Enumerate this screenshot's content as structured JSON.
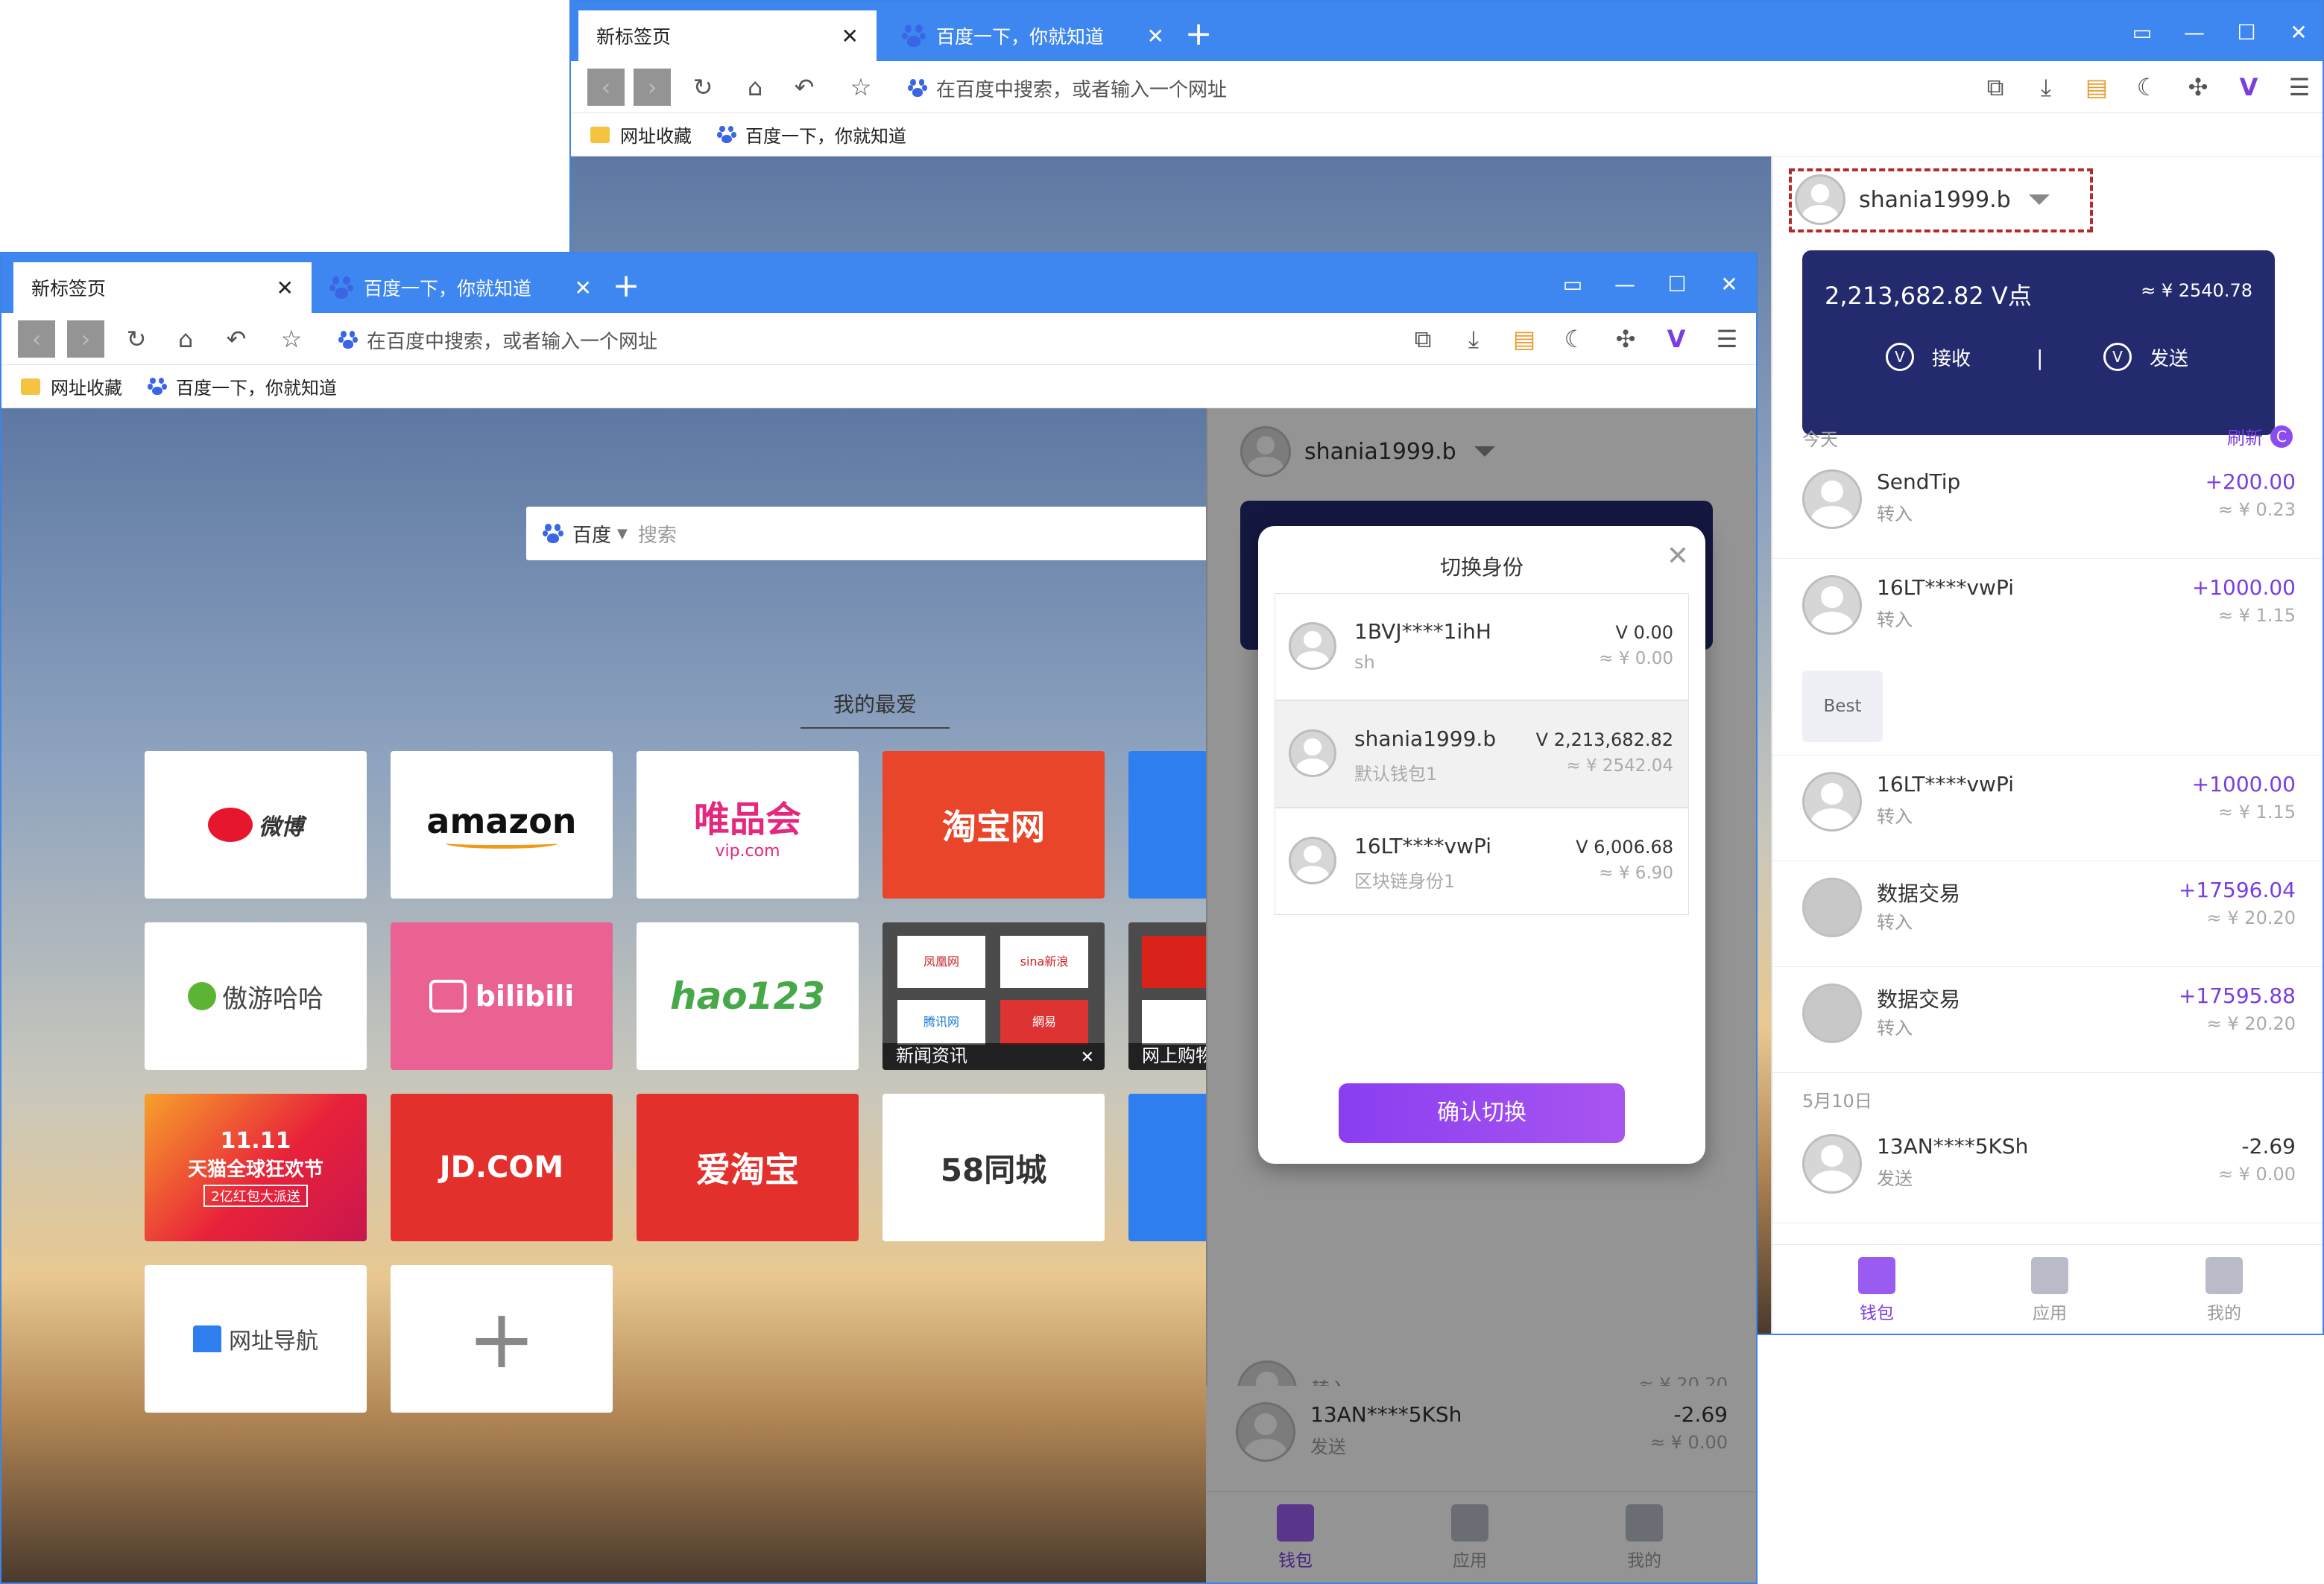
{
  "browser": {
    "tabs": [
      {
        "label": "新标签页"
      },
      {
        "label": "百度一下，你就知道"
      }
    ],
    "address_placeholder": "在百度中搜索，或者输入一个网址",
    "bookmarks": [
      {
        "label": "网址收藏"
      },
      {
        "label": "百度一下，你就知道"
      }
    ]
  },
  "wallet": {
    "account": "shania1999.b",
    "balance": "2,213,682.82 V点",
    "balance_cny": "≈ ¥ 2540.78",
    "receive": "接收",
    "send": "发送",
    "divider": "|",
    "today": "今天",
    "refresh": "刷新",
    "tooltip": "Best",
    "day2": "5月10日",
    "transactions": [
      {
        "name": "SendTip",
        "sub": "转入",
        "amount": "+200.00",
        "cny": "≈ ¥ 0.23"
      },
      {
        "name": "16LT****vwPi",
        "sub": "转入",
        "amount": "+1000.00",
        "cny": "≈ ¥ 1.15"
      },
      {
        "name": "16LT****vwPi",
        "sub": "转入",
        "amount": "+1000.00",
        "cny": "≈ ¥ 1.15"
      },
      {
        "name": "数据交易",
        "sub": "转入",
        "amount": "+17596.04",
        "cny": "≈ ¥ 20.20"
      },
      {
        "name": "数据交易",
        "sub": "转入",
        "amount": "+17595.88",
        "cny": "≈ ¥ 20.20"
      },
      {
        "name": "13AN****5KSh",
        "sub": "发送",
        "amount": "-2.69",
        "cny": "≈ ¥ 0.00"
      }
    ],
    "bg_row_sub": "转入",
    "bg_row_cny": "≈ ¥ 20.20",
    "nav": [
      "钱包",
      "应用",
      "我的"
    ]
  },
  "newtab": {
    "search_engine": "百度",
    "search_placeholder": "搜索",
    "favorites_title": "我的最爱",
    "tiles": {
      "weibo": "微博",
      "amazon": "amazon",
      "vip": "唯品会",
      "vip_sub": "vip.com",
      "taobao": "淘宝网",
      "aoyou": "傲游哈哈",
      "bilibili": "bilibili",
      "hao123": "hao123",
      "news": "新闻资讯",
      "news_logos": [
        "凤凰网",
        "sina新浪",
        "腾讯网",
        "網易"
      ],
      "shop": "网上购物",
      "tmall": "11.11",
      "tmall_line1": "天猫全球狂欢节",
      "tmall_line2": "2亿红包大派送",
      "jd": "JD.COM",
      "aitaobao": "爱淘宝",
      "tongcheng": "58同城",
      "daohang": "网址导航"
    }
  },
  "modal": {
    "title": "切换身份",
    "items": [
      {
        "name": "1BVJ****1ihH",
        "sub": "sh",
        "v": "V 0.00",
        "cny": "≈ ¥ 0.00"
      },
      {
        "name": "shania1999.b",
        "sub": "默认钱包1",
        "v": "V 2,213,682.82",
        "cny": "≈ ¥ 2542.04"
      },
      {
        "name": "16LT****vwPi",
        "sub": "区块链身份1",
        "v": "V 6,006.68",
        "cny": "≈ ¥ 6.90"
      }
    ],
    "confirm": "确认切换"
  },
  "colors": {
    "tab_blue": "#3f87f0",
    "wallet_navy": "#232a6e",
    "accent_purple": "#7a3ee0",
    "highlight_dash": "#b22a2a"
  }
}
